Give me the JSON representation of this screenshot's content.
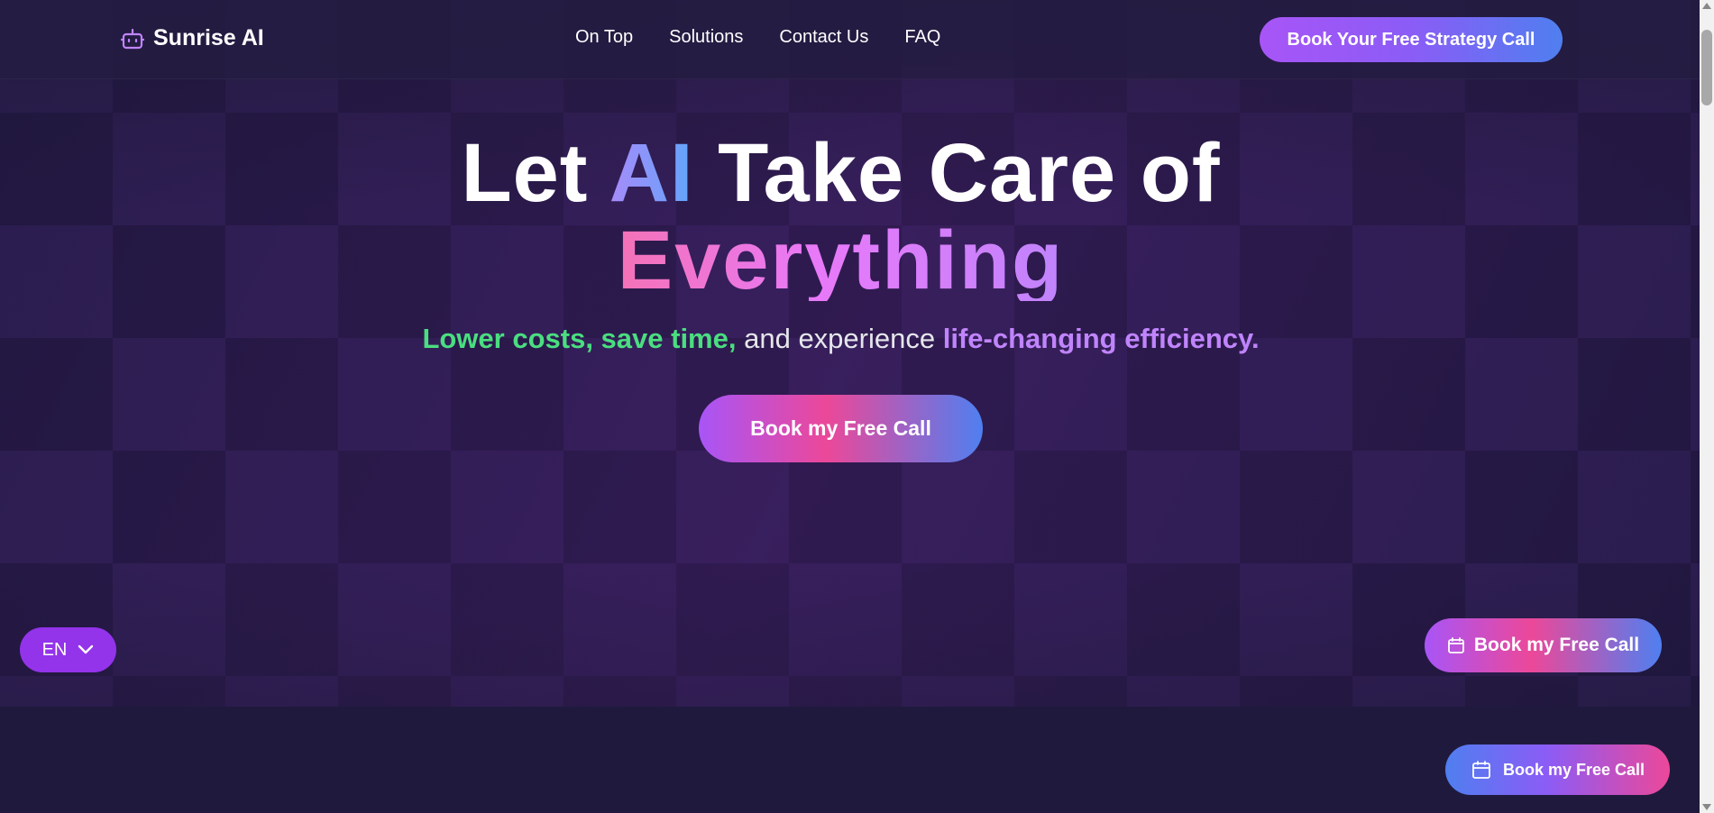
{
  "brand": {
    "name": "Sunrise AI",
    "icon": "robot-icon",
    "accent_color": "#a855f7"
  },
  "nav": {
    "items": [
      {
        "label": "On Top"
      },
      {
        "label": "Solutions"
      },
      {
        "label": "Contact Us"
      },
      {
        "label": "FAQ"
      }
    ],
    "cta_label": "Book Your Free Strategy Call"
  },
  "hero": {
    "headline_prefix": "Let",
    "headline_highlight": "AI",
    "headline_suffix": "Take Care of",
    "headline_line2": "Everything",
    "sub_green": "Lower costs, save time,",
    "sub_plain": "and experience",
    "sub_purple": "life-changing efficiency.",
    "cta_label": "Book my Free Call"
  },
  "language": {
    "selected": "EN",
    "icon": "chevron-down-icon"
  },
  "floating": {
    "primary_label": "Book my Free Call",
    "secondary_label": "Book my Free Call",
    "icon": "calendar-icon"
  },
  "colors": {
    "background": "#1e1838",
    "green": "#4ade80",
    "purple": "#c084fc",
    "pink": "#ec4899",
    "blue": "#4f7ff0"
  }
}
